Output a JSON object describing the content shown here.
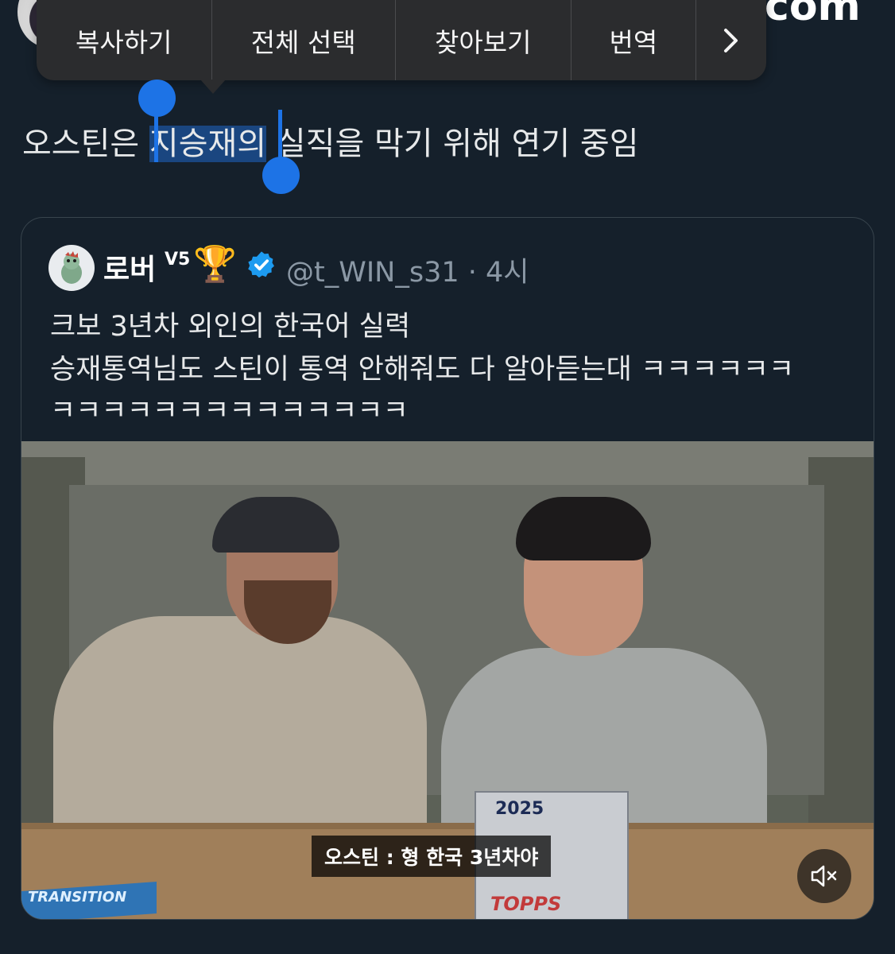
{
  "header": {
    "com_text": "com"
  },
  "context_menu": {
    "copy": "복사하기",
    "select_all": "전체 선택",
    "look_up": "찾아보기",
    "translate": "번역",
    "more_icon": "chevron-right-icon"
  },
  "tweet": {
    "text_before": "오스틴은 ",
    "text_selected": "지승재의",
    "text_after": " 실직을 막기 위해 연기 중임"
  },
  "quote": {
    "display_name": "로버",
    "level_badge": "V5",
    "trophy": "🏆",
    "handle": "@t_WIN_s31",
    "separator": "·",
    "time": "4시",
    "lines": [
      "크보 3년차 외인의 한국어 실력",
      "승재통역님도 스틴이 통역 안해줘도 다 알아듣는대 ㅋㅋㅋㅋㅋㅋ",
      "ㅋㅋㅋㅋㅋㅋㅋㅋㅋㅋㅋㅋㅋㅋ"
    ],
    "media": {
      "caption": "오스틴 : 형 한국 3년차야",
      "box_label": "2025",
      "box_brand": "TOPPS",
      "card_text": "TRANSITION",
      "mute_icon": "speaker-muted-icon"
    }
  },
  "colors": {
    "background": "#15202b",
    "selection": "#1a4680",
    "handle": "#1d73e6",
    "verified": "#1d9bf0",
    "muted_text": "#8b98a5"
  }
}
